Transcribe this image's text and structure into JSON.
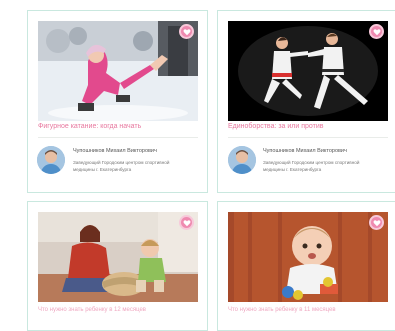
{
  "cards": [
    {
      "title": "Фигурное катание: когда начать",
      "author": {
        "name": "Чупошников Михаил Викторович",
        "description": "Заведующий Городским центром спортивной медицины г. Екатеринбурга"
      },
      "favorite_icon": "heart-icon"
    },
    {
      "title": "Единоборства: за или против",
      "author": {
        "name": "Чупошников Михаил Викторович",
        "description": "Заведующий Городским центром спортивной медицины г. Екатеринбурга"
      },
      "favorite_icon": "heart-icon"
    },
    {
      "title": "Что нужно знать ребенку в 12 месяцев",
      "favorite_icon": "heart-icon"
    },
    {
      "title": "Что нужно знать ребенку в 11 месяцев",
      "favorite_icon": "heart-icon"
    }
  ],
  "colors": {
    "card_border": "#c9e8df",
    "accent_pink": "#e8789f"
  }
}
